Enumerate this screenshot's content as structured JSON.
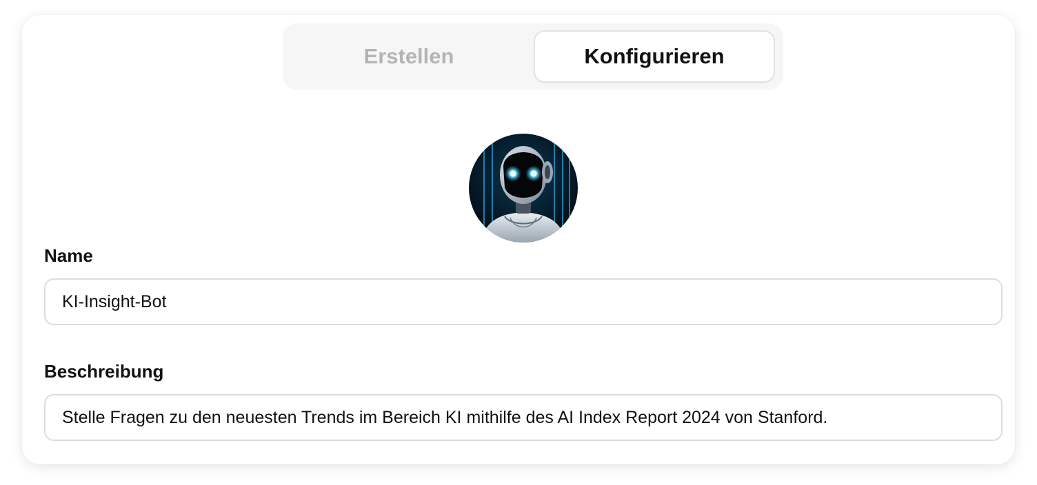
{
  "tabs": {
    "create_label": "Erstellen",
    "configure_label": "Konfigurieren",
    "active": "configure"
  },
  "avatar": {
    "icon": "robot-avatar",
    "accent_color": "#2ec5ff"
  },
  "form": {
    "name_label": "Name",
    "name_value": "KI-Insight-Bot",
    "description_label": "Beschreibung",
    "description_value": "Stelle Fragen zu den neuesten Trends im Bereich KI mithilfe des AI Index Report 2024 von Stanford."
  }
}
